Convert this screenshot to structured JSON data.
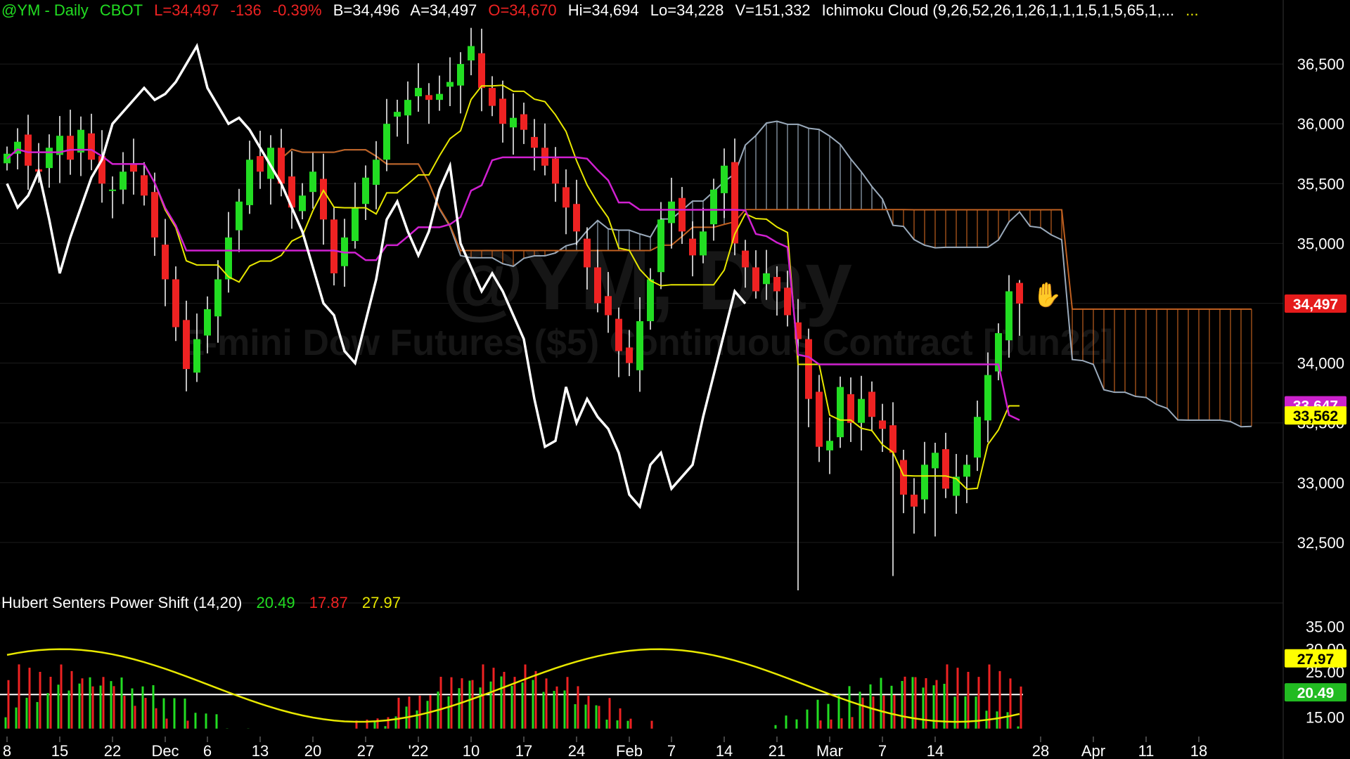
{
  "header": {
    "symbol": "@YM - Daily",
    "exchange": "CBOT",
    "last": "L=34,497",
    "change": "-136",
    "change_pct": "-0.39%",
    "bid": "B=34,496",
    "ask": "A=34,497",
    "open": "O=34,670",
    "high": "Hi=34,694",
    "low": "Lo=34,228",
    "volume": "V=151,332",
    "study": "Ichimoku Cloud (9,26,52,26,1,26,1,1,1,5,1,5,65,1,...",
    "more": "..."
  },
  "watermark": {
    "symbol": "@YM, Day",
    "description": "E-mini Dow Futures ($5) Continuous Contract [Jun22]"
  },
  "sub_header": {
    "name": "Hubert Senters Power Shift (14,20)",
    "v1": "20.49",
    "v2": "17.87",
    "v3": "27.97"
  },
  "colors": {
    "green": "#22dd22",
    "red": "#ee2222",
    "yellow": "#e8e800",
    "magenta": "#d020d0",
    "white": "#ffffff",
    "cloud_line": "#9aaabb",
    "cloud_orange": "#c06020",
    "label_red": "#e51b1b",
    "label_yellow": "#ffff00",
    "label_magenta": "#cc22cc",
    "label_green": "#22bb22"
  },
  "chart_data": [
    {
      "type": "candlestick",
      "title": "",
      "ylim": [
        32100,
        36800
      ],
      "y_ticks": [
        "32,500",
        "33,000",
        "33,500",
        "34,000",
        "34,500",
        "35,000",
        "35,500",
        "36,000",
        "36,500"
      ],
      "y_tick_values": [
        32500,
        33000,
        33500,
        34000,
        34500,
        35000,
        35500,
        36000,
        36500
      ],
      "x_ticks": [
        "8",
        "15",
        "22",
        "Dec",
        "6",
        "13",
        "20",
        "27",
        "'22",
        "10",
        "17",
        "24",
        "Feb",
        "7",
        "14",
        "21",
        "Mar",
        "7",
        "14",
        "28",
        "Apr",
        "11",
        "18"
      ],
      "x_tick_index": [
        0,
        5,
        10,
        15,
        19,
        24,
        29,
        34,
        39,
        44,
        49,
        54,
        59,
        63,
        68,
        73,
        78,
        83,
        88,
        98,
        103,
        108,
        113
      ],
      "price_labels": [
        {
          "text": "34,497",
          "value": 34497,
          "bg": "#e51b1b",
          "fg": "#ffffff"
        },
        {
          "text": "33,647",
          "value": 33647,
          "bg": "#cc22cc",
          "fg": "#ffffff"
        },
        {
          "text": "33,562",
          "value": 33562,
          "bg": "#ffff00",
          "fg": "#000000"
        }
      ],
      "series": [
        {
          "name": "price",
          "points_owned_by_script": true
        }
      ]
    },
    {
      "type": "bar",
      "title": "",
      "ylim": [
        12,
        38
      ],
      "y_ticks": [
        "15.00",
        "20.00",
        "25.00",
        "30.00",
        "35.00"
      ],
      "y_tick_values": [
        15,
        20,
        25,
        30,
        35
      ],
      "labels": [
        {
          "text": "27.97",
          "value": 27.97,
          "bg": "#ffff00",
          "fg": "#000000"
        },
        {
          "text": "20.49",
          "value": 20.49,
          "bg": "#22bb22",
          "fg": "#ffffff"
        }
      ]
    }
  ]
}
